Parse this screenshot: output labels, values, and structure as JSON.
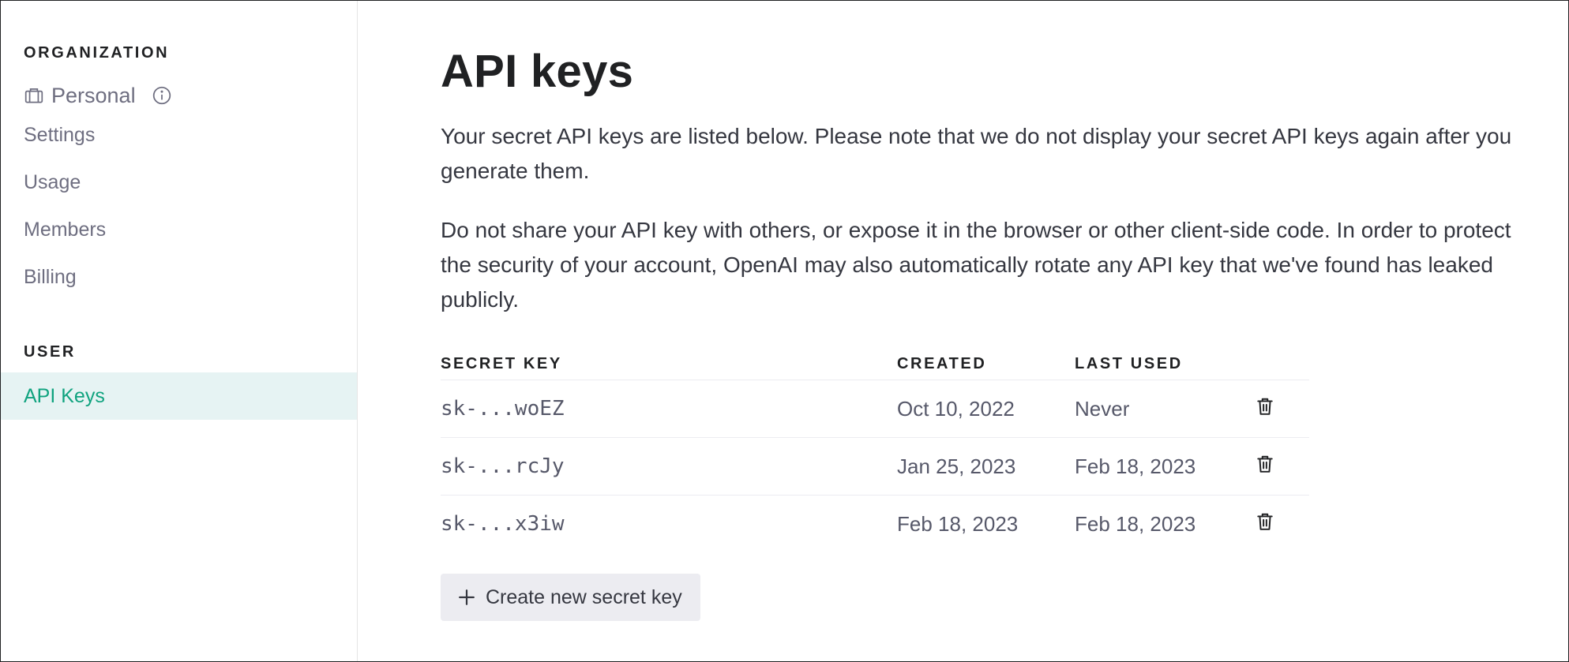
{
  "sidebar": {
    "org_heading": "ORGANIZATION",
    "org_name": "Personal",
    "org_items": [
      {
        "label": "Settings"
      },
      {
        "label": "Usage"
      },
      {
        "label": "Members"
      },
      {
        "label": "Billing"
      }
    ],
    "user_heading": "USER",
    "user_items": [
      {
        "label": "API Keys",
        "active": true
      }
    ]
  },
  "main": {
    "title": "API keys",
    "paragraph1": "Your secret API keys are listed below. Please note that we do not display your secret API keys again after you generate them.",
    "paragraph2": "Do not share your API key with others, or expose it in the browser or other client-side code. In order to protect the security of your account, OpenAI may also automatically rotate any API key that we've found has leaked publicly.",
    "table": {
      "headers": {
        "key": "SECRET KEY",
        "created": "CREATED",
        "last_used": "LAST USED"
      },
      "rows": [
        {
          "key": "sk-...woEZ",
          "created": "Oct 10, 2022",
          "last_used": "Never"
        },
        {
          "key": "sk-...rcJy",
          "created": "Jan 25, 2023",
          "last_used": "Feb 18, 2023"
        },
        {
          "key": "sk-...x3iw",
          "created": "Feb 18, 2023",
          "last_used": "Feb 18, 2023"
        }
      ]
    },
    "create_button_label": "Create new secret key"
  },
  "icons": {
    "org": "briefcase-icon",
    "info": "info-icon",
    "delete": "trash-icon",
    "add": "plus-icon"
  },
  "colors": {
    "accent": "#10a37f",
    "active_bg": "#e6f3f3",
    "button_bg": "#ececf1"
  }
}
